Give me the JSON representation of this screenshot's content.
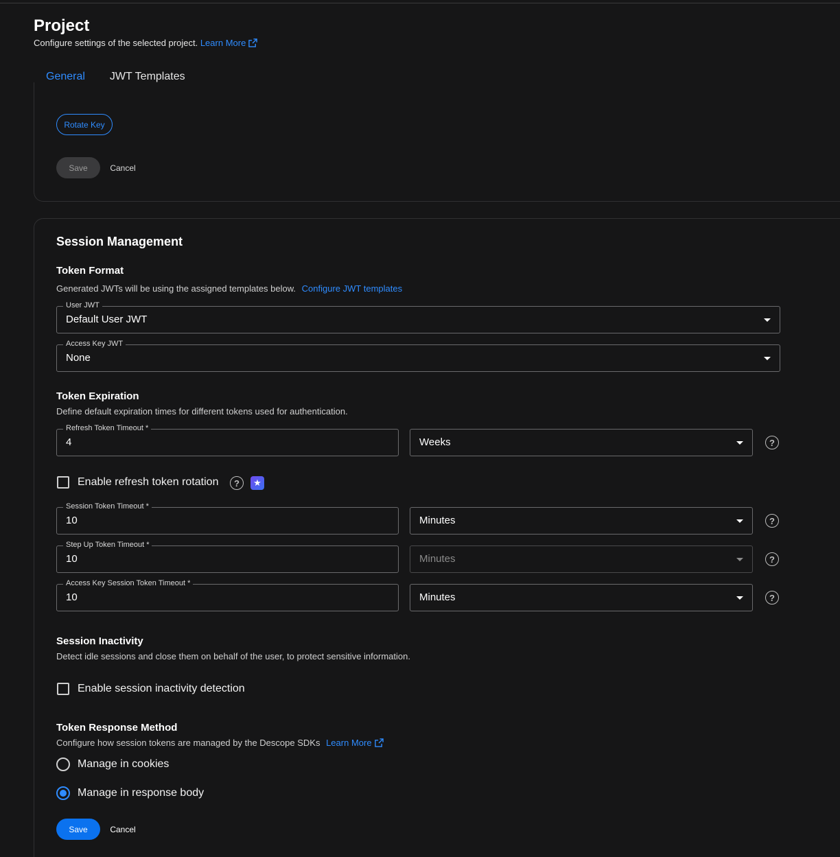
{
  "header": {
    "title": "Project",
    "subtitle": "Configure settings of the selected project.",
    "learn_more": "Learn More"
  },
  "tabs": [
    {
      "label": "General",
      "active": true
    },
    {
      "label": "JWT Templates",
      "active": false
    }
  ],
  "key_card": {
    "rotate_key": "Rotate Key",
    "save": "Save",
    "cancel": "Cancel"
  },
  "session_management": {
    "title": "Session Management",
    "token_format": {
      "title": "Token Format",
      "description": "Generated JWTs will be using the assigned templates below.",
      "configure_link": "Configure JWT templates",
      "user_jwt": {
        "label": "User JWT",
        "value": "Default User JWT"
      },
      "access_key_jwt": {
        "label": "Access Key JWT",
        "value": "None"
      }
    },
    "token_expiration": {
      "title": "Token Expiration",
      "description": "Define default expiration times for different tokens used for authentication.",
      "refresh": {
        "label": "Refresh Token Timeout *",
        "value": "4",
        "unit": "Weeks"
      },
      "rotation": {
        "label": "Enable refresh token rotation",
        "checked": false
      },
      "session": {
        "label": "Session Token Timeout *",
        "value": "10",
        "unit": "Minutes"
      },
      "step_up": {
        "label": "Step Up Token Timeout *",
        "value": "10",
        "unit": "Minutes"
      },
      "access_key_session": {
        "label": "Access Key Session Token Timeout *",
        "value": "10",
        "unit": "Minutes"
      }
    },
    "session_inactivity": {
      "title": "Session Inactivity",
      "description": "Detect idle sessions and close them on behalf of the user, to protect sensitive information.",
      "enable": {
        "label": "Enable session inactivity detection",
        "checked": false
      }
    },
    "token_response": {
      "title": "Token Response Method",
      "description": "Configure how session tokens are managed by the Descope SDKs",
      "learn_more": "Learn More",
      "options": [
        {
          "label": "Manage in cookies",
          "selected": false
        },
        {
          "label": "Manage in response body",
          "selected": true
        }
      ]
    },
    "save": "Save",
    "cancel": "Cancel"
  },
  "colors": {
    "accent": "#2f8cff",
    "primary_button": "#0b72ef",
    "background": "#161617"
  },
  "icons": {
    "external_link": "external-link-icon",
    "help": "help-circle-icon",
    "star": "star-icon",
    "dropdown": "caret-down-icon"
  }
}
